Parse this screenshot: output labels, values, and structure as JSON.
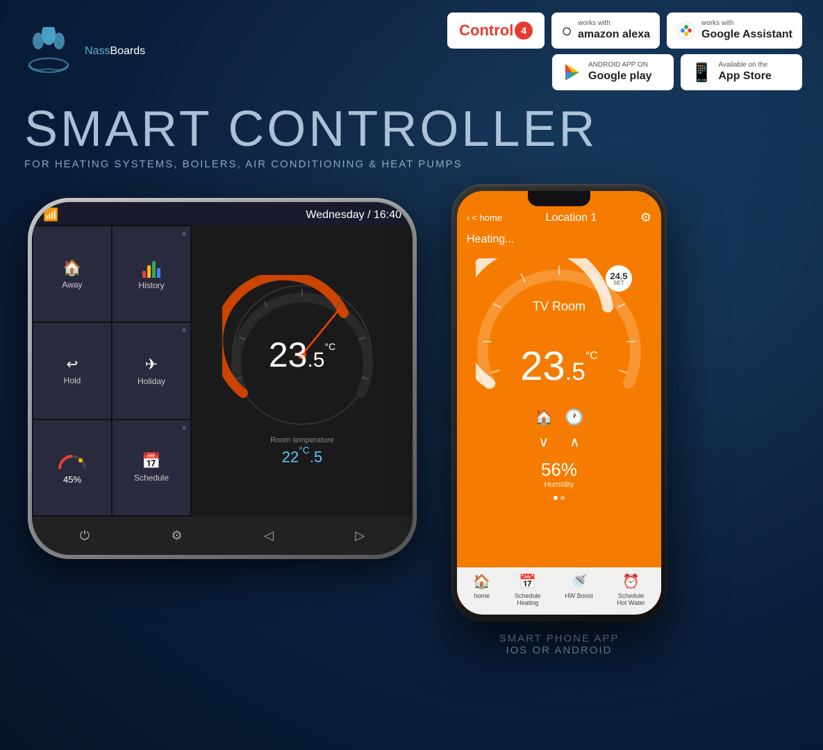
{
  "brand": {
    "name_part1": "Nass",
    "name_part2": "Boards",
    "logo_alt": "NassBoards Logo"
  },
  "hero": {
    "title": "SMART CONTROLLER",
    "subtitle": "FOR HEATING SYSTEMS, BOILERS, AIR CONDITIONING & HEAT PUMPS"
  },
  "badges": {
    "control4": "Control",
    "alexa_pre": "works with",
    "alexa_main": "amazon alexa",
    "assistant_pre": "works with",
    "assistant_main": "Google Assistant",
    "google_play_pre": "ANDROID APP ON",
    "google_play_main": "Google play",
    "appstore_pre": "Available on the",
    "appstore_main": "App Store"
  },
  "thermostat": {
    "wifi": "📶",
    "datetime": "Wednesday / 16:40",
    "buttons": [
      {
        "label": "Away",
        "icon": "🏠"
      },
      {
        "label": "History",
        "icon": "chart"
      },
      {
        "label": "Hold",
        "icon": "↩"
      },
      {
        "label": "Holiday",
        "icon": "✈"
      },
      {
        "label": "45%",
        "icon": "gauge"
      },
      {
        "label": "Schedule",
        "icon": "📅"
      }
    ],
    "room_temp_main": "23",
    "room_temp_decimal": ".5",
    "room_temp_unit": "°C",
    "room_label": "Room temperature",
    "target_temp": "22",
    "target_decimal": ".5",
    "target_unit": "°C"
  },
  "phone": {
    "back_label": "< home",
    "location": "Location 1",
    "heating_status": "Heating...",
    "room_name": "TV Room",
    "current_temp_main": "23",
    "current_temp_decimal": ".5",
    "current_temp_unit": "°C",
    "target_temp": "24.5",
    "target_temp_sub": "SET",
    "humidity_value": "56%",
    "humidity_label": "Humidity",
    "nav_items": [
      {
        "label": "home",
        "icon": "🏠"
      },
      {
        "label": "Schedule\nHeating",
        "icon": "📅"
      },
      {
        "label": "HW Boost",
        "icon": "🚿"
      },
      {
        "label": "Schedule\nHot Water",
        "icon": "⏰"
      }
    ]
  },
  "footer": {
    "caption_line1": "SMART PHONE APP",
    "caption_line2": "IOS or ANDROID"
  }
}
